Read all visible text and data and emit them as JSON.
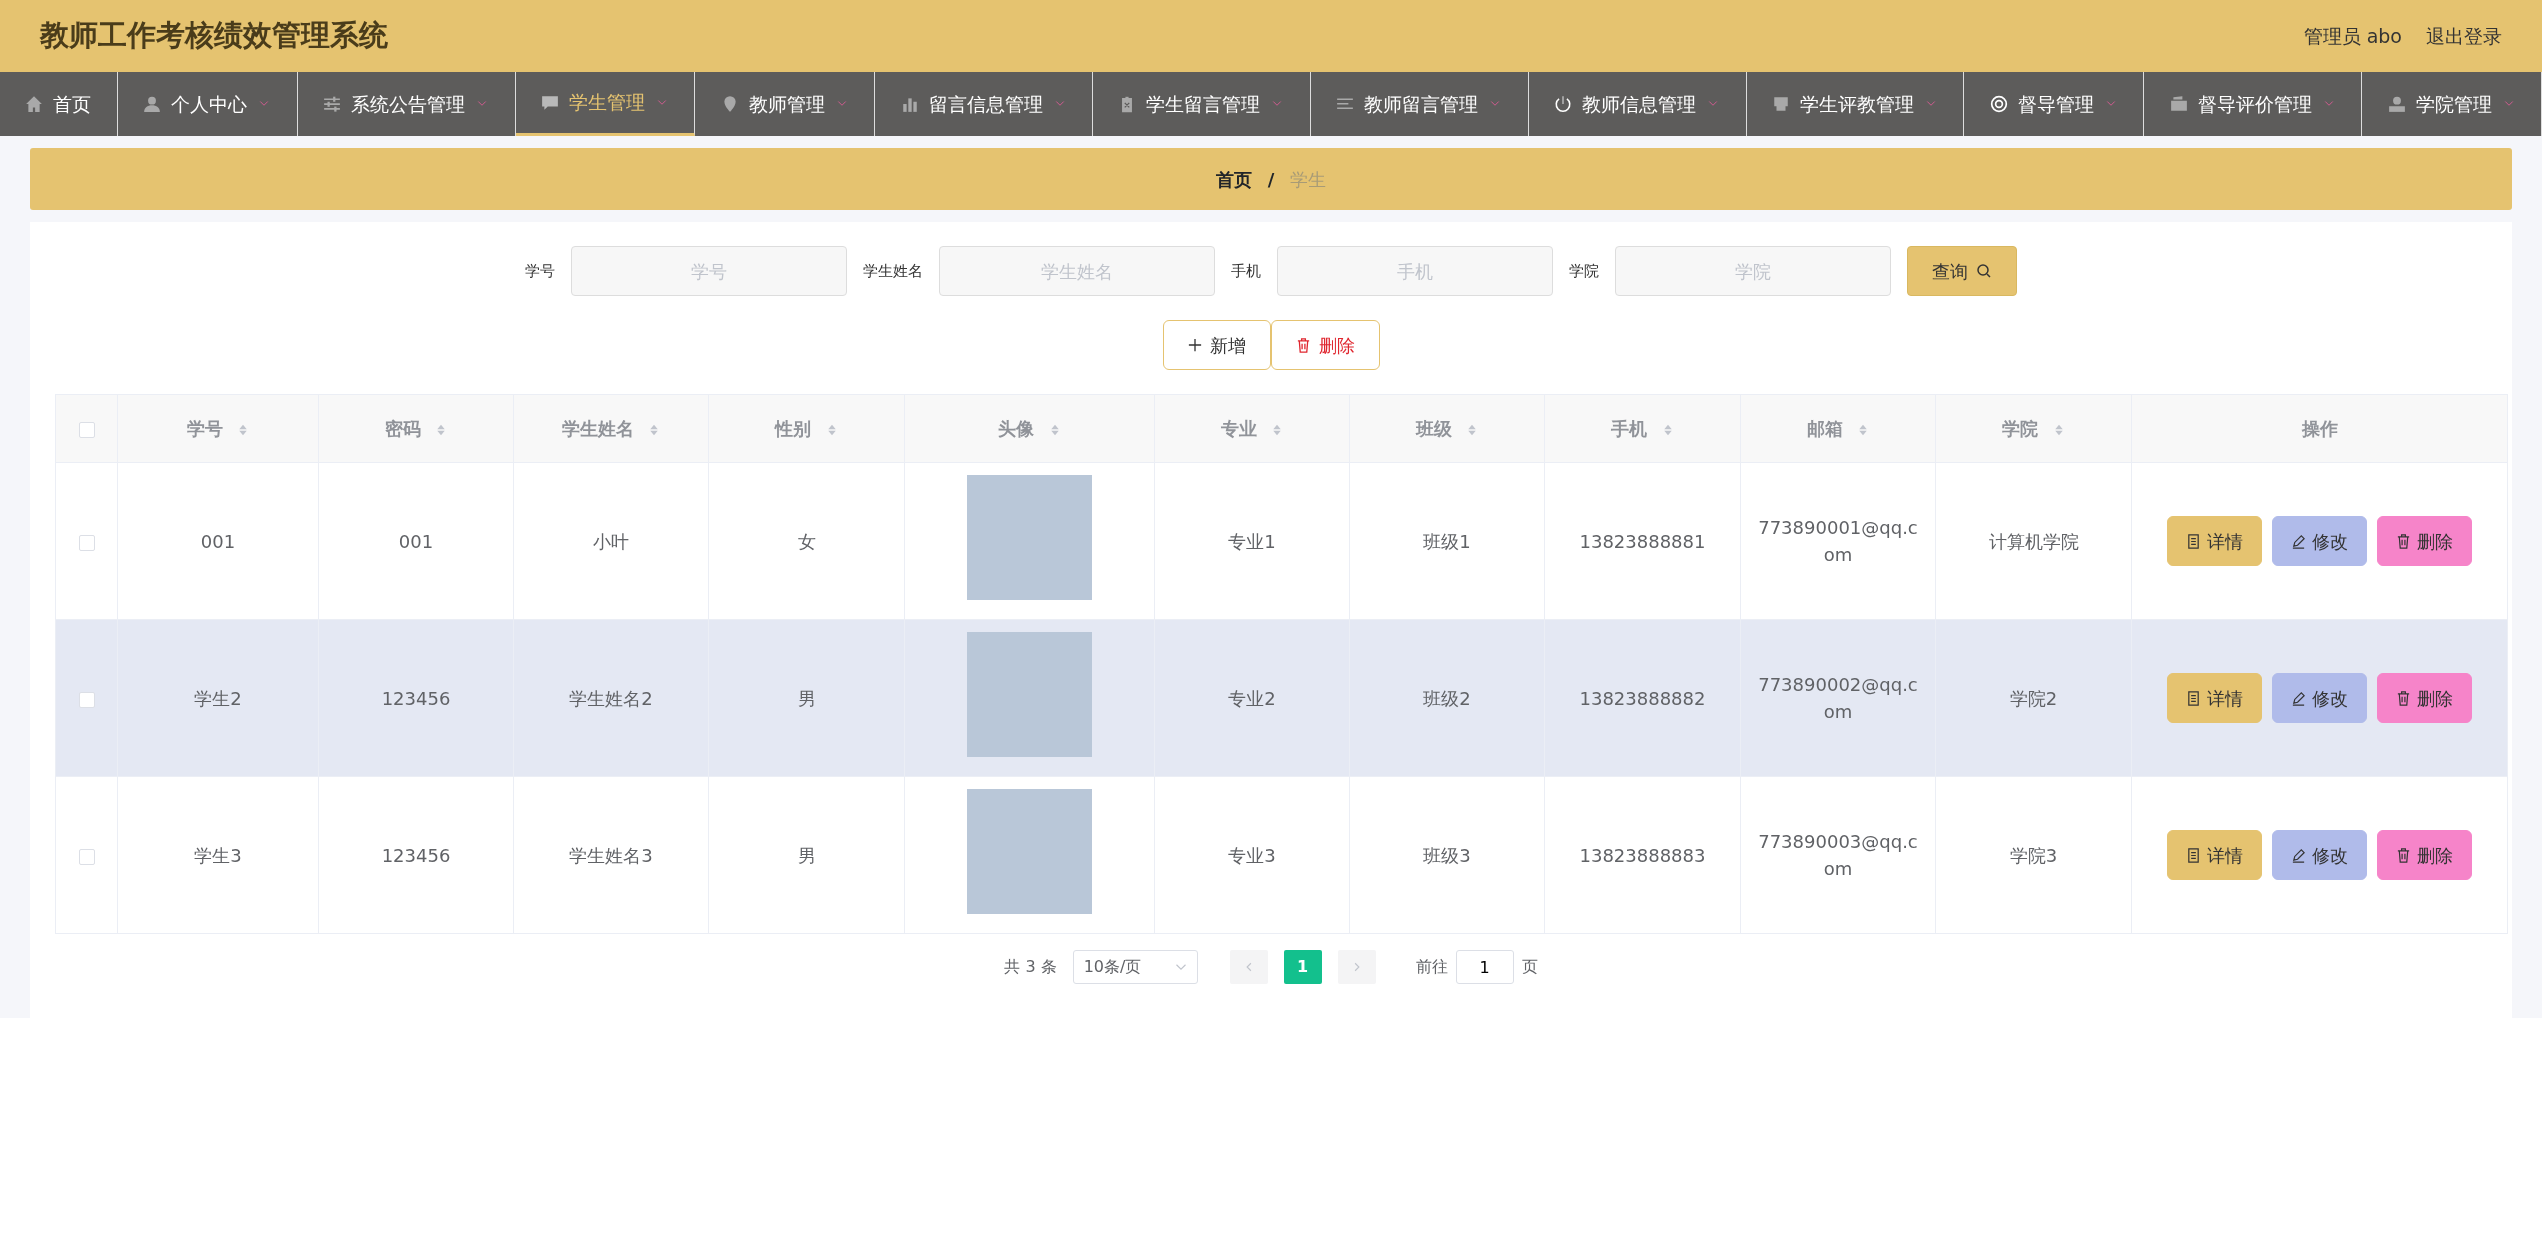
{
  "header": {
    "title": "教师工作考核绩效管理系统",
    "user": "管理员 abo",
    "logout": "退出登录"
  },
  "nav": [
    {
      "label": "首页",
      "selected": false,
      "dropdown": false
    },
    {
      "label": "个人中心",
      "selected": false,
      "dropdown": true
    },
    {
      "label": "系统公告管理",
      "selected": false,
      "dropdown": true
    },
    {
      "label": "学生管理",
      "selected": true,
      "dropdown": true
    },
    {
      "label": "教师管理",
      "selected": false,
      "dropdown": true
    },
    {
      "label": "留言信息管理",
      "selected": false,
      "dropdown": true
    },
    {
      "label": "学生留言管理",
      "selected": false,
      "dropdown": true
    },
    {
      "label": "教师留言管理",
      "selected": false,
      "dropdown": true
    },
    {
      "label": "教师信息管理",
      "selected": false,
      "dropdown": true
    },
    {
      "label": "学生评教管理",
      "selected": false,
      "dropdown": true
    },
    {
      "label": "督导管理",
      "selected": false,
      "dropdown": true
    },
    {
      "label": "督导评价管理",
      "selected": false,
      "dropdown": true
    },
    {
      "label": "学院管理",
      "selected": false,
      "dropdown": true
    }
  ],
  "breadcrumb": {
    "items": [
      "首页",
      "学生"
    ],
    "separator": "/"
  },
  "search": {
    "fields": [
      {
        "label": "学号",
        "placeholder": "学号"
      },
      {
        "label": "学生姓名",
        "placeholder": "学生姓名"
      },
      {
        "label": "手机",
        "placeholder": "手机"
      },
      {
        "label": "学院",
        "placeholder": "学院"
      }
    ],
    "button": "查询"
  },
  "actions": [
    {
      "kind": "add",
      "label": "新增"
    },
    {
      "kind": "delete",
      "label": "删除"
    }
  ],
  "table": {
    "columns": [
      {
        "label": "学号",
        "sortable": true
      },
      {
        "label": "密码",
        "sortable": true
      },
      {
        "label": "学生姓名",
        "sortable": true
      },
      {
        "label": "性别",
        "sortable": true
      },
      {
        "label": "头像",
        "sortable": true
      },
      {
        "label": "专业",
        "sortable": true
      },
      {
        "label": "班级",
        "sortable": true
      },
      {
        "label": "手机",
        "sortable": true
      },
      {
        "label": "邮箱",
        "sortable": true
      },
      {
        "label": "学院",
        "sortable": true
      },
      {
        "label": "操作",
        "sortable": false
      }
    ],
    "header_checked": false,
    "rows": [
      {
        "checked": false,
        "hovered": false,
        "cells": [
          "001",
          "001",
          "小叶",
          "女",
          "",
          "专业1",
          "班级1",
          "13823888881",
          "773890001@qq.com",
          "计算机学院"
        ],
        "buttons": [
          {
            "kind": "detail",
            "label": "详情"
          },
          {
            "kind": "edit",
            "label": "修改"
          },
          {
            "kind": "delete",
            "label": "删除"
          }
        ]
      },
      {
        "checked": false,
        "hovered": true,
        "cells": [
          "学生2",
          "123456",
          "学生姓名2",
          "男",
          "",
          "专业2",
          "班级2",
          "13823888882",
          "773890002@qq.com",
          "学院2"
        ],
        "buttons": [
          {
            "kind": "detail",
            "label": "详情"
          },
          {
            "kind": "edit",
            "label": "修改"
          },
          {
            "kind": "delete",
            "label": "删除"
          }
        ]
      },
      {
        "checked": false,
        "hovered": false,
        "cells": [
          "学生3",
          "123456",
          "学生姓名3",
          "男",
          "",
          "专业3",
          "班级3",
          "13823888883",
          "773890003@qq.com",
          "学院3"
        ],
        "buttons": [
          {
            "kind": "detail",
            "label": "详情"
          },
          {
            "kind": "edit",
            "label": "修改"
          },
          {
            "kind": "delete",
            "label": "删除"
          }
        ]
      }
    ]
  },
  "pagination": {
    "total": "共 3 条",
    "page_size": "10条/页",
    "pages": [
      {
        "label": "1",
        "selected": true
      }
    ],
    "goto_label": "前往",
    "goto_value": "1",
    "goto_suffix": "页"
  }
}
